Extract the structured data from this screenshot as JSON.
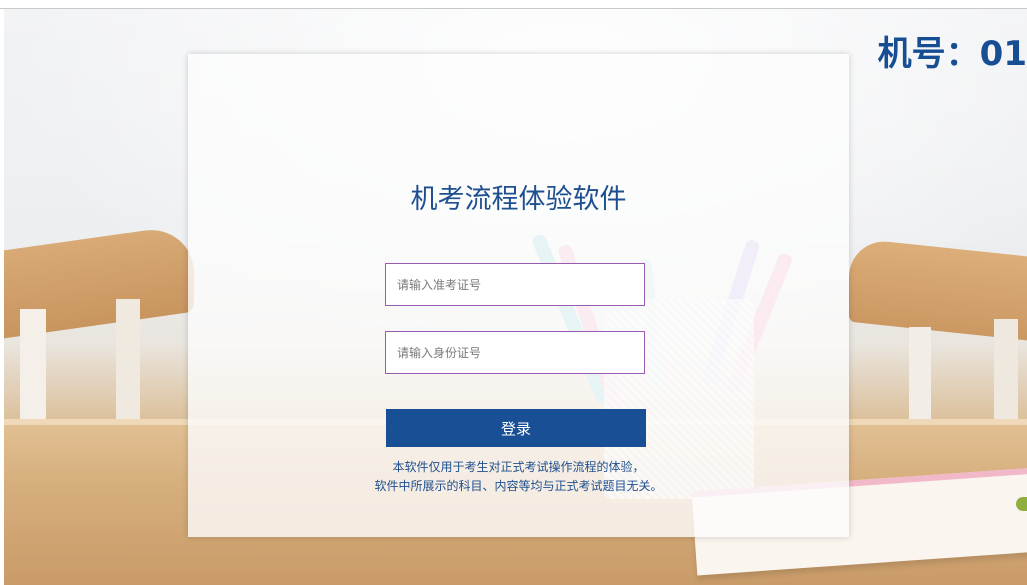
{
  "header": {
    "machine_number": "机号：01"
  },
  "login": {
    "title": "机考流程体验软件",
    "exam_id_placeholder": "请输入准考证号",
    "id_card_placeholder": "请输入身份证号",
    "login_label": "登录",
    "disclaimer_line1": "本软件仅用于考生对正式考试操作流程的体验，",
    "disclaimer_line2": "软件中所展示的科目、内容等均与正式考试题目无关。"
  },
  "colors": {
    "accent": "#184f95",
    "title": "#1e4f8f",
    "input_border": "#9a5ab0"
  }
}
